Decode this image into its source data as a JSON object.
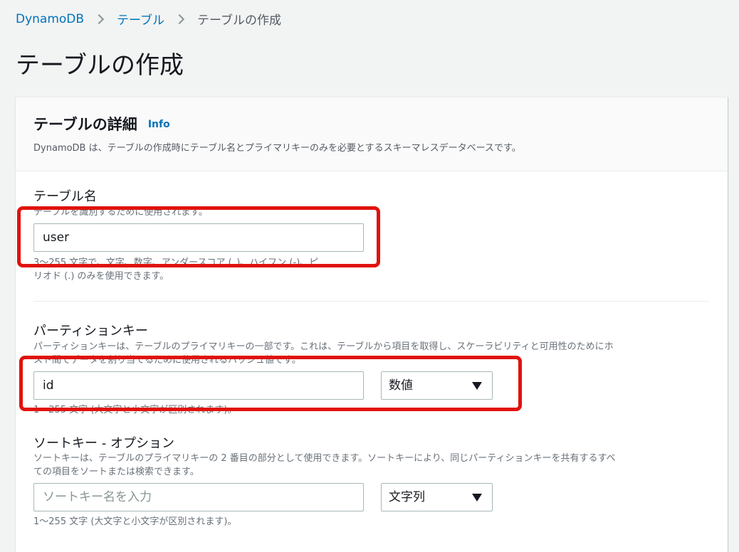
{
  "breadcrumb": {
    "root": "DynamoDB",
    "parent": "テーブル",
    "current": "テーブルの作成"
  },
  "page_title": "テーブルの作成",
  "panel": {
    "title": "テーブルの詳細",
    "info": "Info",
    "description": "DynamoDB は、テーブルの作成時にテーブル名とプライマリキーのみを必要とするスキーマレスデータベースです。"
  },
  "table_name": {
    "label": "テーブル名",
    "description": "テーブルを識別するために使用されます。",
    "value": "user",
    "constraint_line1": "3～255 文字で、文字、数字、アンダースコア (_)、ハイフン (-)、ピ",
    "constraint_line2": "リオド (.) のみを使用できます。"
  },
  "partition_key": {
    "label": "パーティションキー",
    "description_line1": "パーティションキーは、テーブルのプライマリキーの一部です。これは、テーブルから項目を取得し、スケーラビリティと可用性のためにホ",
    "description_line2": "スト間でデータを割り当てるために使用されるハッシュ値です。",
    "value": "id",
    "type_selected": "数値",
    "constraint": "1～255 文字 (大文字と小文字が区別されます)。"
  },
  "sort_key": {
    "label": "ソートキー - オプション",
    "description_line1": "ソートキーは、テーブルのプライマリキーの 2 番目の部分として使用できます。ソートキーにより、同じパーティションキーを共有するすべ",
    "description_line2": "ての項目をソートまたは検索できます。",
    "placeholder": "ソートキー名を入力",
    "type_selected": "文字列",
    "constraint": "1～255 文字 (大文字と小文字が区別されます)。"
  },
  "colors": {
    "link": "#0073bb",
    "annotation": "#e0120c",
    "background": "#f2f3f3"
  }
}
